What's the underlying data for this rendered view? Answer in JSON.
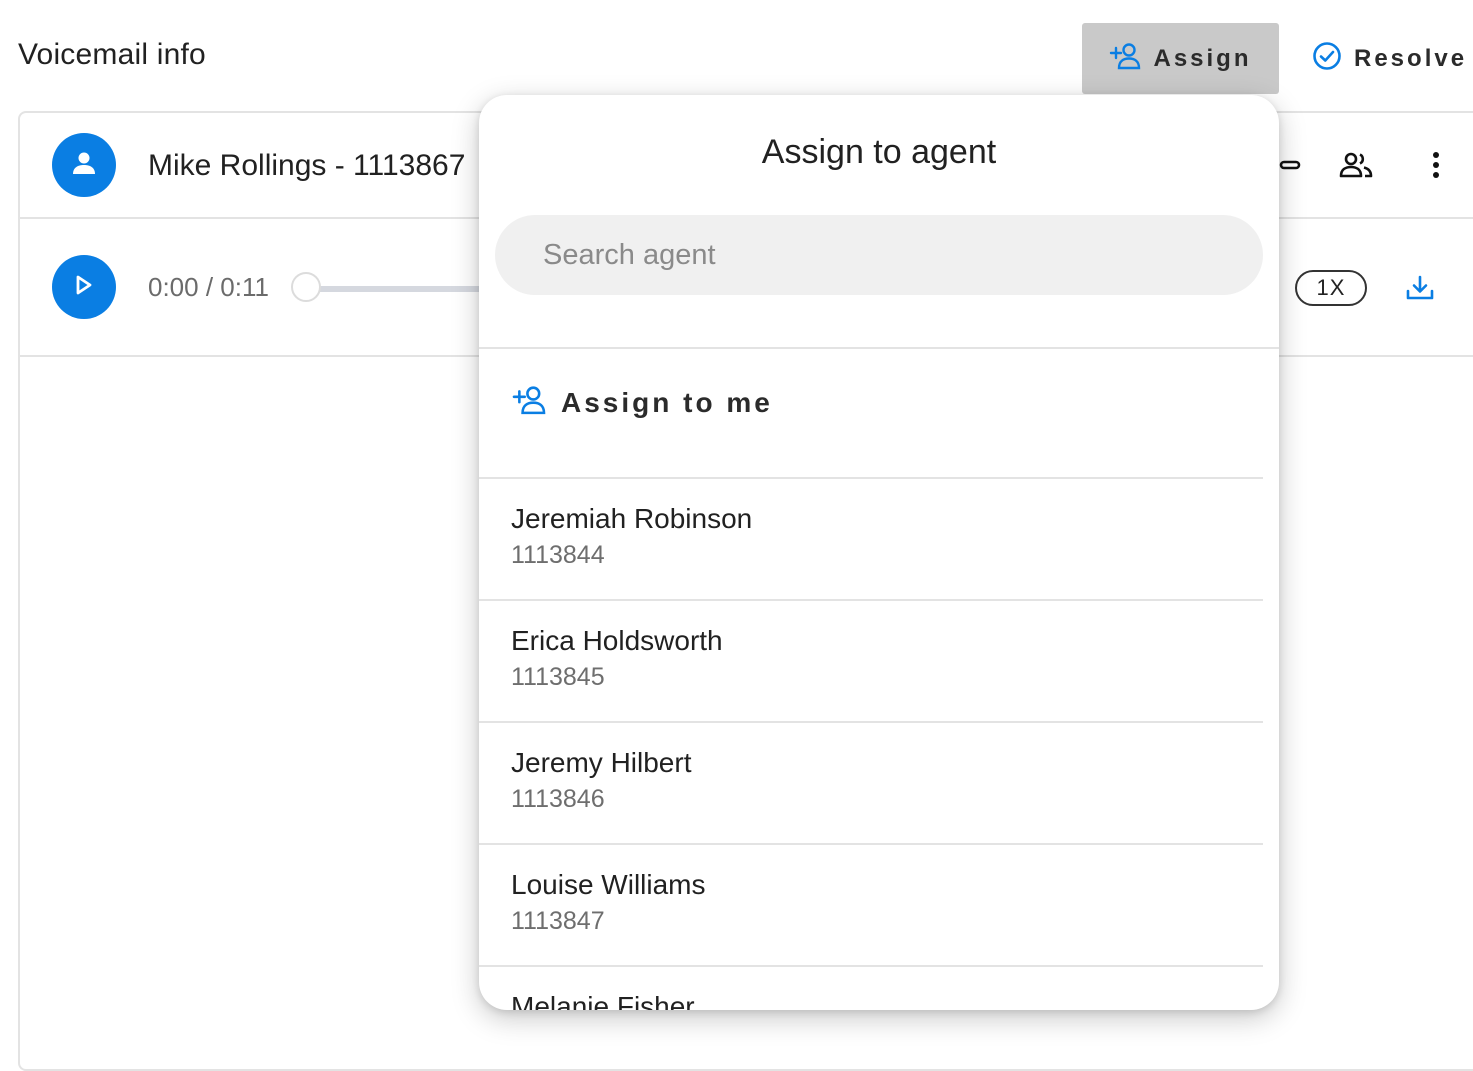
{
  "header": {
    "title": "Voicemail info",
    "assign_label": "Assign",
    "resolve_label": "Resolve"
  },
  "voicemail": {
    "contact": "Mike Rollings - 1113867",
    "time": "0:00 / 0:11",
    "progress": 0,
    "speed": "1X"
  },
  "assign_popover": {
    "title": "Assign to agent",
    "search_placeholder": "Search agent",
    "assign_to_me": "Assign to me",
    "agents": [
      {
        "name": "Jeremiah Robinson",
        "ext": "1113844"
      },
      {
        "name": "Erica Holdsworth",
        "ext": "1113845"
      },
      {
        "name": "Jeremy Hilbert",
        "ext": "1113846"
      },
      {
        "name": "Louise Williams",
        "ext": "1113847"
      },
      {
        "name": "Melanie Fisher",
        "ext": ""
      }
    ]
  },
  "colors": {
    "accent": "#0a7ee3",
    "assign_button_bg": "#c9c9c9",
    "divider": "#e3e3e3"
  },
  "icons": {
    "assign": "person-add-icon",
    "resolve": "check-circle-icon",
    "avatar": "person-icon",
    "play": "play-icon",
    "participants": "group-icon",
    "more": "more-vert-icon",
    "download": "download-icon"
  }
}
